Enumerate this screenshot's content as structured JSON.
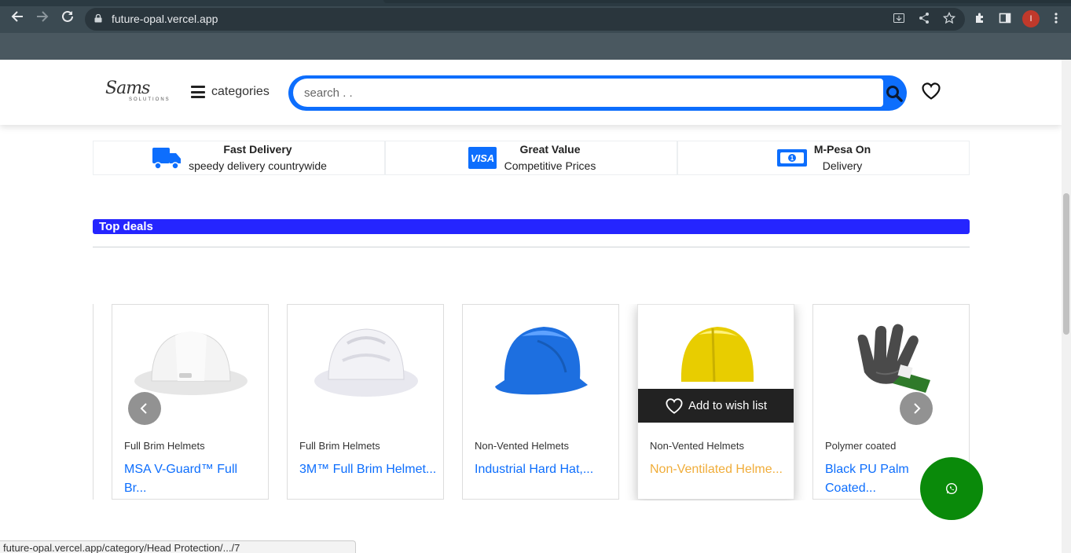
{
  "browser": {
    "url": "future-opal.vercel.app",
    "profile_initial": "I"
  },
  "header": {
    "logo_script": "Sams",
    "logo_sub": "SOLUTIONS",
    "categories_label": "categories",
    "search_placeholder": "search . ."
  },
  "features": [
    {
      "title": "Fast Delivery",
      "subtitle": "speedy delivery countrywide",
      "icon": "truck-icon"
    },
    {
      "title": "Great Value",
      "subtitle": "Competitive Prices",
      "icon": "visa-card-icon",
      "icon_text": "VISA"
    },
    {
      "title": "M-Pesa On",
      "subtitle": "Delivery",
      "icon": "banknote-icon"
    }
  ],
  "deals": {
    "heading": "Top deals",
    "wish_label": "Add to wish list",
    "products": [
      {
        "category": "Full Brim Helmets",
        "name": "MSA V-Guard™ Full Br...",
        "image": "white-full-brim-helmet"
      },
      {
        "category": "Full Brim Helmets",
        "name": "3M™ Full Brim Helmet...",
        "image": "white-vented-helmet"
      },
      {
        "category": "Non-Vented Helmets",
        "name": "Industrial Hard Hat,...",
        "image": "blue-hard-hat"
      },
      {
        "category": "Non-Vented Helmets",
        "name": "Non-Ventilated Helme...",
        "image": "yellow-hard-hat"
      },
      {
        "category": "Polymer coated",
        "name": "Black PU Palm Coated...",
        "image": "black-green-glove"
      }
    ]
  },
  "status_url": "future-opal.vercel.app/category/Head Protection/.../7",
  "colors": {
    "primary": "#0d6efd",
    "deals_bar": "#2525ff",
    "hover_name": "#f0ad3a",
    "whatsapp": "#0a8a0a"
  }
}
